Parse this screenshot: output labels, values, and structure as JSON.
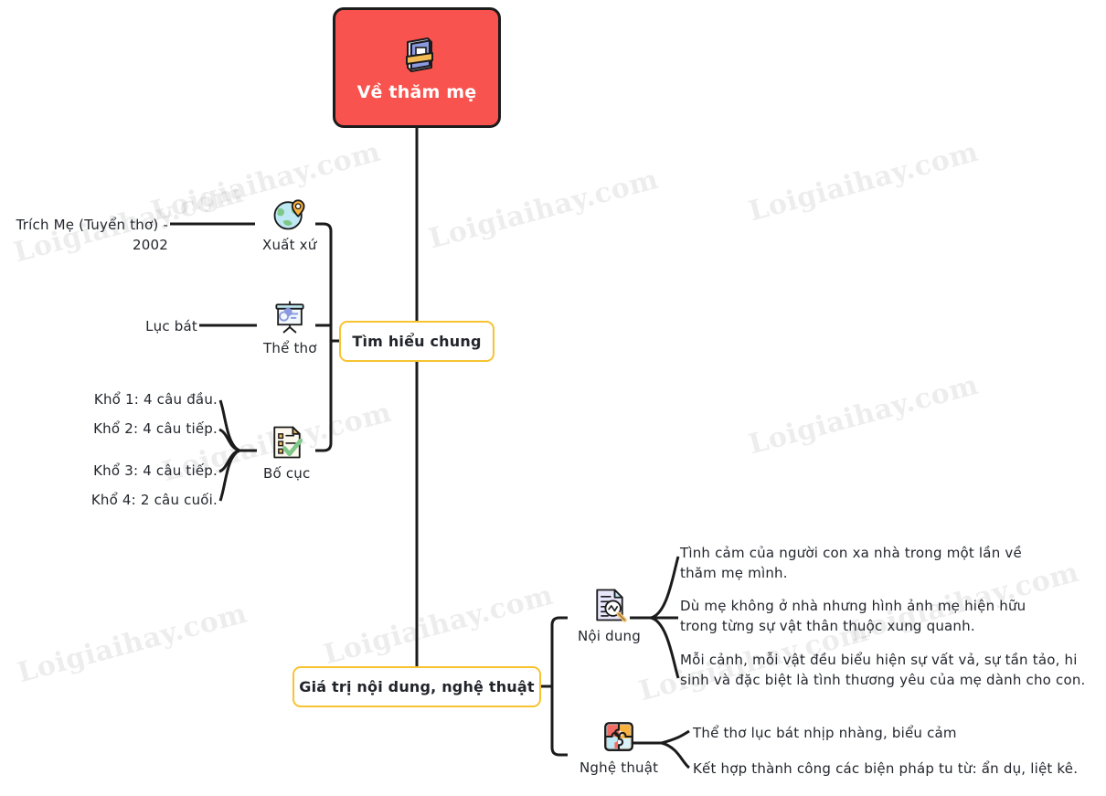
{
  "watermark": {
    "text": "Loigiaihay.com"
  },
  "colors": {
    "root_fill": "#f9534f",
    "root_border": "#1b1b1b",
    "root_text": "#ffffff",
    "branch_border": "#f7c331",
    "branch_fill": "#ffffff",
    "text": "#23262d",
    "wire": "#1b1b1b"
  },
  "root": {
    "label": "Về thăm mẹ",
    "icon": "book-icon"
  },
  "branches": [
    {
      "id": "branch-1",
      "label": "Tìm hiểu chung",
      "topics": [
        {
          "caption": "Xuất xứ",
          "icon": "globe-location-icon",
          "leaves": [
            "Trích Mẹ (Tuyển thơ) - 2002"
          ]
        },
        {
          "caption": "Thể thơ",
          "icon": "presentation-chart-icon",
          "leaves": [
            "Lục bát"
          ]
        },
        {
          "caption": "Bố cục",
          "icon": "checklist-document-icon",
          "leaves": [
            "Khổ 1: 4 câu đầu.",
            "Khổ 2: 4 câu tiếp.",
            "Khổ 3: 4 câu tiếp.",
            "Khổ 4: 2 câu cuối."
          ]
        }
      ]
    },
    {
      "id": "branch-2",
      "label": "Giá trị nội dung, nghệ thuật",
      "topics": [
        {
          "caption": "Nội dung",
          "icon": "document-search-icon",
          "leaves": [
            "Tình cảm của người con xa nhà trong một lần về\nthăm mẹ mình.",
            "Dù mẹ không ở nhà nhưng hình ảnh mẹ hiện hữu\ntrong từng sự vật thân thuộc xung quanh.",
            "Mỗi cảnh, mỗi vật đều biểu hiện sự vất vả, sự tần tảo, hi\nsinh và đặc biệt là tình thương yêu của mẹ dành cho con."
          ]
        },
        {
          "caption": "Nghệ thuật",
          "icon": "puzzle-icon",
          "leaves": [
            "Thể thơ lục bát nhịp nhàng, biểu cảm",
            "Kết hợp thành công các biện pháp tu từ: ẩn dụ, liệt kê."
          ]
        }
      ]
    }
  ]
}
